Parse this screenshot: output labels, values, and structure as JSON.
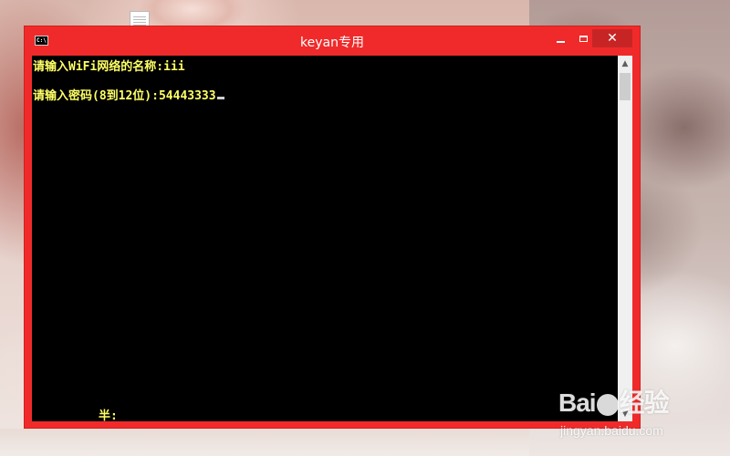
{
  "window": {
    "title": "keyan专用",
    "icon": "console-app-icon",
    "icon_text": "C:\\",
    "accent_color": "#f02a2a"
  },
  "console": {
    "line1": "请输入WiFi网络的名称:iii",
    "line2": "请输入密码(8到12位):54443333",
    "ime_status": "半:",
    "text_color": "#ffff66",
    "background_color": "#000000"
  },
  "controls": {
    "minimize_icon": "minimize-icon",
    "maximize_icon": "maximize-icon",
    "close_icon": "close-icon",
    "close_glyph": "✕"
  },
  "scrollbar": {
    "up_glyph": "▲",
    "down_glyph": "▼"
  },
  "watermark": {
    "logo": "Bai  经验",
    "logo_after": "经验",
    "url": "jingyan.baidu.com"
  }
}
